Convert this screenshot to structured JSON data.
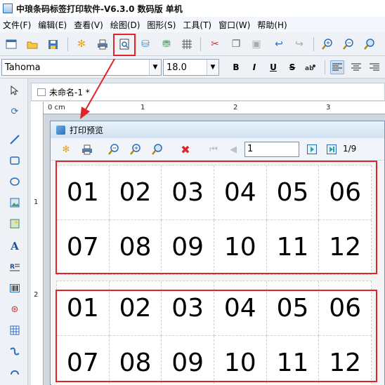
{
  "app": {
    "title": "中琅条码标签打印软件-V6.3.0 数码版 单机"
  },
  "menu": [
    "文件(F)",
    "编辑(E)",
    "查看(V)",
    "绘图(D)",
    "图形(S)",
    "工具(T)",
    "窗口(W)",
    "帮助(H)"
  ],
  "toolbar": {
    "icons": [
      "new-icon",
      "open-icon",
      "save-icon",
      "settings-icon",
      "print-icon",
      "print-preview-icon",
      "database-icon",
      "data-source-icon",
      "grid-icon",
      "cut-icon",
      "copy-icon",
      "paste-icon",
      "undo-icon",
      "redo-icon",
      "zoom-in-icon",
      "zoom-out-icon",
      "zoom-fit-icon"
    ]
  },
  "format": {
    "font_family": "Tahoma",
    "font_size": "18.0",
    "bold": "B",
    "italic": "I",
    "underline": "U",
    "strike": "S"
  },
  "left_tools": [
    "select",
    "rotate",
    "line",
    "rect",
    "ellipse",
    "image",
    "picture",
    "text",
    "rich-text",
    "barcode",
    "qrcode",
    "table",
    "curve",
    "arc"
  ],
  "document": {
    "tab_title": "未命名-1 *"
  },
  "ruler": {
    "h_labels": [
      "0 cm",
      "1",
      "2",
      "3"
    ],
    "v_labels": [
      "1",
      "2"
    ]
  },
  "dialog": {
    "title": "打印预览",
    "page_input": "1",
    "page_count": "1/9"
  },
  "labels": {
    "page_row_1": [
      "01",
      "02",
      "03",
      "04",
      "05",
      "06",
      "07",
      "08",
      "09",
      "10",
      "11",
      "12"
    ],
    "page_row_2": [
      "01",
      "02",
      "03",
      "04",
      "05",
      "06",
      "07",
      "08",
      "09",
      "10",
      "11",
      "12"
    ]
  },
  "colors": {
    "highlight": "#e2232a",
    "title_accent": "#2c6fb3"
  }
}
